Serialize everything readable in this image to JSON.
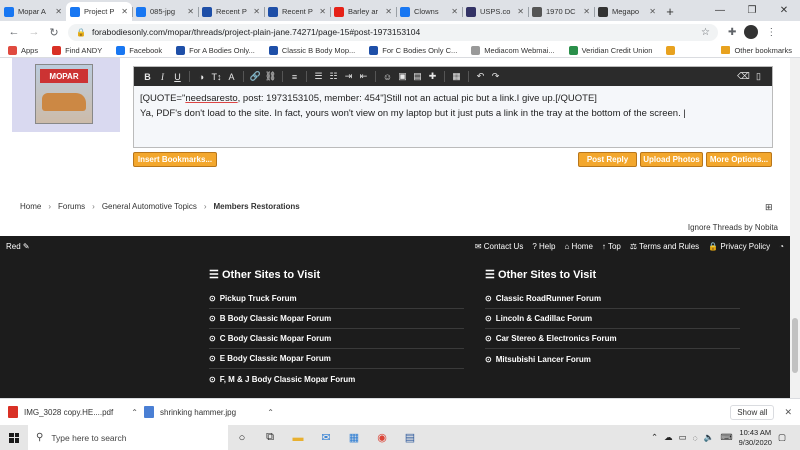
{
  "browser": {
    "tabs": [
      {
        "label": "Mopar A",
        "color": "#1877f2"
      },
      {
        "label": "Project P",
        "color": "#1877f2",
        "active": true
      },
      {
        "label": "085-jpg",
        "color": "#1877f2"
      },
      {
        "label": "Recent P",
        "color": "#1e4fa8"
      },
      {
        "label": "Recent P",
        "color": "#1e4fa8"
      },
      {
        "label": "Barley ar",
        "color": "#e62117"
      },
      {
        "label": "Clowns",
        "color": "#1877f2"
      },
      {
        "label": "USPS.co",
        "color": "#333366"
      },
      {
        "label": "1970 DC",
        "color": "#555555"
      },
      {
        "label": "Megapo",
        "color": "#333333"
      }
    ],
    "url": "forabodiesonly.com/mopar/threads/project-plain-jane.74271/page-15#post-1973153104",
    "bookmarks": [
      {
        "label": "Apps",
        "color": "#e04a3f"
      },
      {
        "label": "Find ANDY",
        "color": "#d93025"
      },
      {
        "label": "Facebook",
        "color": "#1877f2"
      },
      {
        "label": "For A Bodies Only...",
        "color": "#1e4fa8"
      },
      {
        "label": "Classic B Body Mop...",
        "color": "#1e4fa8"
      },
      {
        "label": "For C Bodies Only C...",
        "color": "#1e4fa8"
      },
      {
        "label": "Mediacom Webmai...",
        "color": "#999999"
      },
      {
        "label": "Veridian Credit Union",
        "color": "#2a8f4a"
      },
      {
        "label": "",
        "color": "#e8a21f"
      }
    ],
    "other_bookmarks": "Other bookmarks"
  },
  "editor": {
    "line1_a": "[QUOTE=\"",
    "line1_user": "needsaresto",
    "line1_b": ", post: 1973153105, member: 454\"]Still not an actual pic but a link.I give up.[/QUOTE]",
    "line2": "Ya, PDF's don't load to the site. In fact, yours won't view on my laptop but it just puts a link in the tray at the bottom of the screen."
  },
  "buttons": {
    "insert_bookmarks": "Insert Bookmarks...",
    "post_reply": "Post Reply",
    "upload_photos": "Upload Photos",
    "more_options": "More Options..."
  },
  "breadcrumb": [
    "Home",
    "Forums",
    "General Automotive Topics",
    "Members Restorations"
  ],
  "ignore_threads": "Ignore Threads by Nobita",
  "footer": {
    "style": "Red",
    "links": [
      "Contact Us",
      "Help",
      "Home",
      "Top",
      "Terms and Rules",
      "Privacy Policy"
    ],
    "col1_title": "Other Sites to Visit",
    "col1": [
      "Pickup Truck Forum",
      "B Body Classic Mopar Forum",
      "C Body Classic Mopar Forum",
      "E Body Classic Mopar Forum",
      "F, M & J Body Classic Mopar Forum"
    ],
    "col2_title": "Other Sites to Visit",
    "col2": [
      "Classic RoadRunner Forum",
      "Lincoln & Cadillac Forum",
      "Car Stereo & Electronics Forum",
      "Mitsubishi Lancer Forum"
    ]
  },
  "downloads": {
    "items": [
      {
        "label": "IMG_3028 copy.HE....pdf",
        "color": "#d93025"
      },
      {
        "label": "shrinking hammer.jpg",
        "color": "#4a7fd4"
      }
    ],
    "show_all": "Show all"
  },
  "taskbar": {
    "search_placeholder": "Type here to search",
    "time": "10:43 AM",
    "date": "9/30/2020"
  }
}
